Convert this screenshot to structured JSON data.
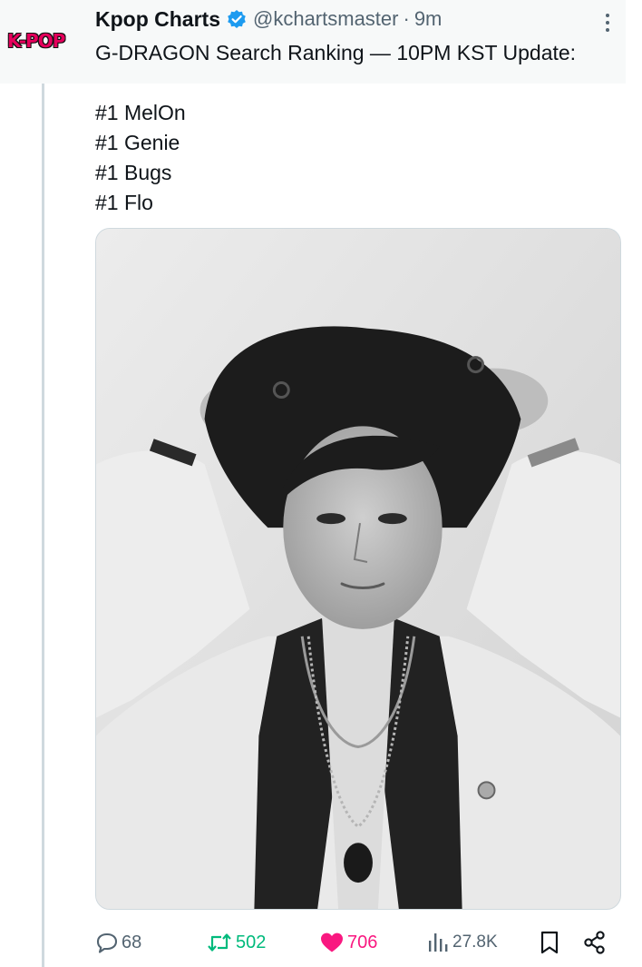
{
  "author": {
    "avatar_text": "K-POP",
    "display_name": "Kpop Charts",
    "verified": true,
    "verified_color": "#1d9bf0",
    "handle": "@kchartsmaster",
    "separator": "·",
    "time": "9m"
  },
  "tweet": {
    "lines": [
      "G-DRAGON Search Ranking — 10PM KST Update:",
      "",
      "#1 MelOn",
      "#1 Genie",
      "#1 Bugs",
      "#1 Flo"
    ]
  },
  "media": {
    "type": "photo",
    "description": "black-and-white portrait photograph"
  },
  "actions": {
    "replies": "68",
    "retweets": "502",
    "likes": "706",
    "liked": true,
    "retweeted": true,
    "views": "27.8K"
  },
  "icons": {
    "more": "more-vertical-icon",
    "reply": "reply-icon",
    "retweet": "retweet-icon",
    "like": "heart-icon",
    "views": "views-icon",
    "bookmark": "bookmark-icon",
    "share": "share-icon",
    "verified": "verified-badge-icon"
  },
  "colors": {
    "like": "#f91880",
    "retweet": "#00ba7c",
    "muted": "#536471",
    "text": "#0f1419"
  }
}
